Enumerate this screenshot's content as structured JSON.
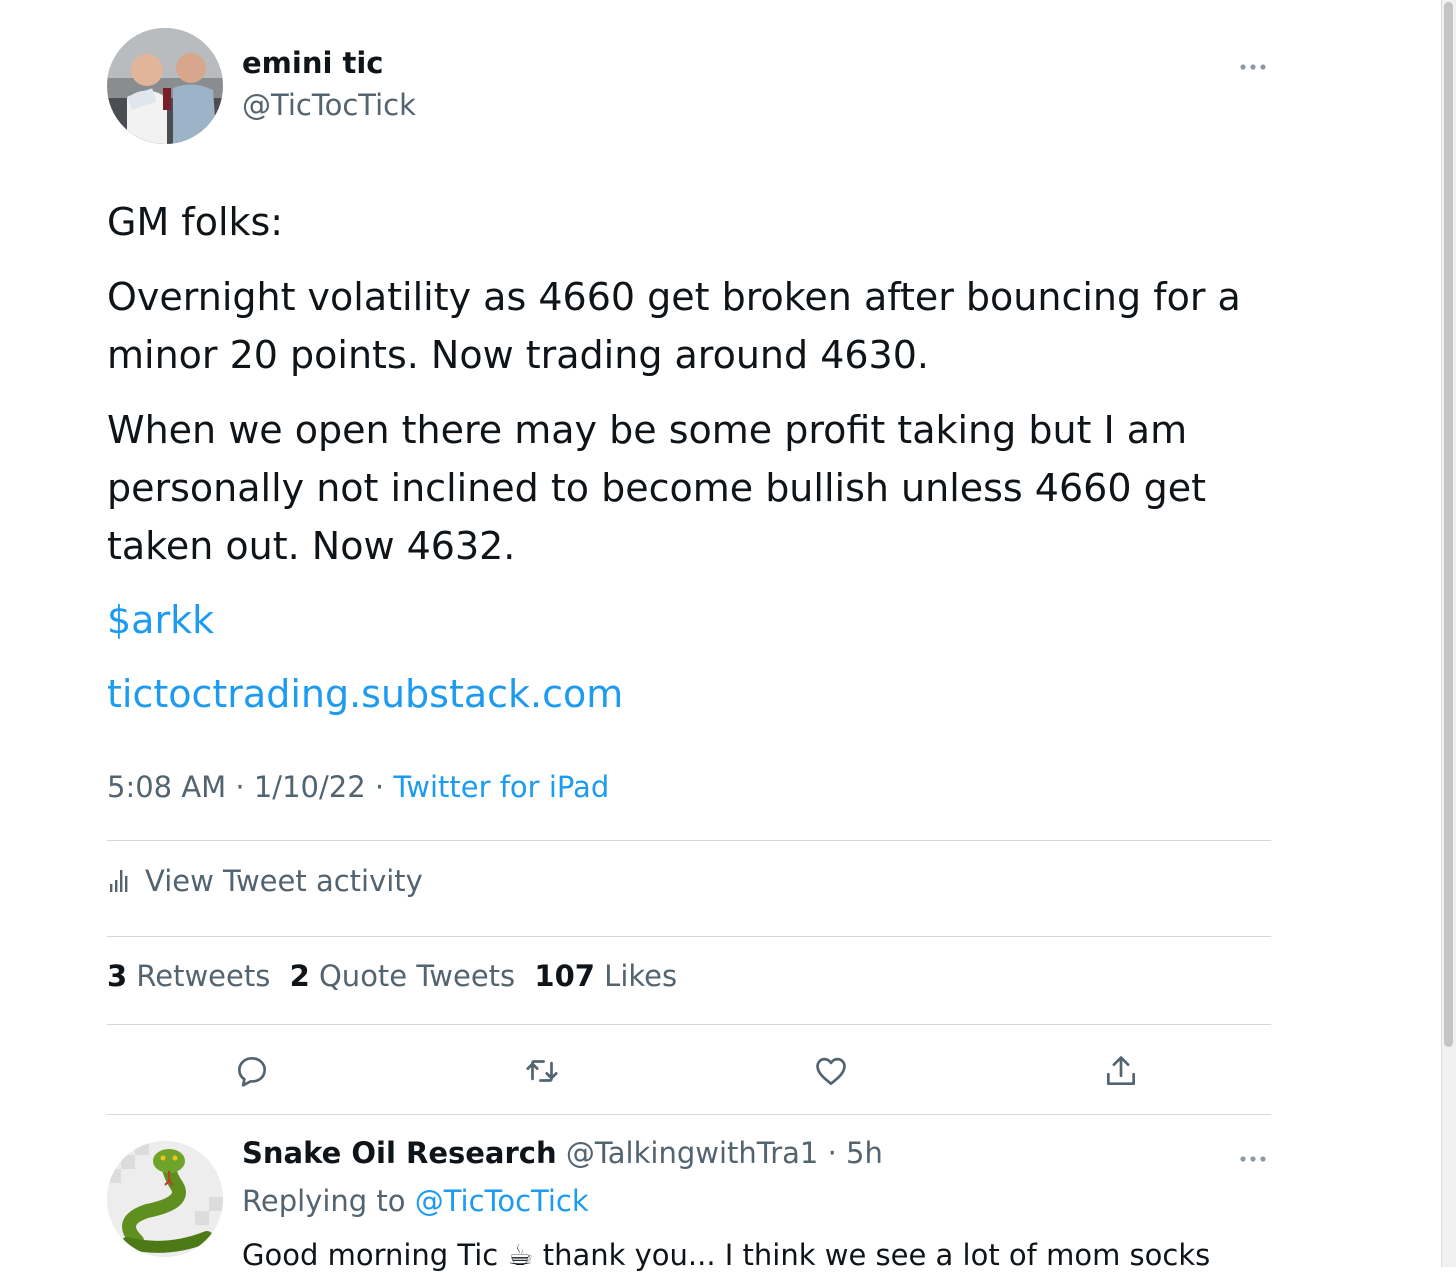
{
  "tweet": {
    "author_name": "emini tic",
    "author_handle": "@TicTocTick",
    "paragraphs": [
      "GM folks:",
      "Overnight volatility as 4660 get broken after bouncing for a minor 20 points. Now trading around 4630.",
      "When we open there may be some profit taking but I am personally not inclined to become bullish unless 4660 get taken out. Now 4632."
    ],
    "cashtag": "$arkk",
    "url": "tictoctrading.substack.com",
    "time": "5:08 AM",
    "date": "1/10/22",
    "source": "Twitter for iPad",
    "separator": " · "
  },
  "activity": {
    "label": "View Tweet activity"
  },
  "stats": {
    "retweets_count": "3",
    "retweets_label": "Retweets",
    "quotes_count": "2",
    "quotes_label": "Quote Tweets",
    "likes_count": "107",
    "likes_label": "Likes"
  },
  "actions": {
    "reply_icon": "reply-icon",
    "retweet_icon": "retweet-icon",
    "like_icon": "heart-icon",
    "share_icon": "share-icon"
  },
  "reply": {
    "author_name": "Snake Oil Research",
    "author_handle": "@TalkingwithTra1",
    "time": "5h",
    "replying_prefix": "Replying to",
    "replying_handle": "@TicTocTick",
    "body_start": "Good morning Tic",
    "body_emoji": "☕",
    "body_end": "thank you... I think we see a lot of mom socks"
  },
  "colors": {
    "link": "#1d9bf0",
    "secondary": "#536471",
    "text": "#0f1419",
    "divider": "#cfd9de"
  }
}
